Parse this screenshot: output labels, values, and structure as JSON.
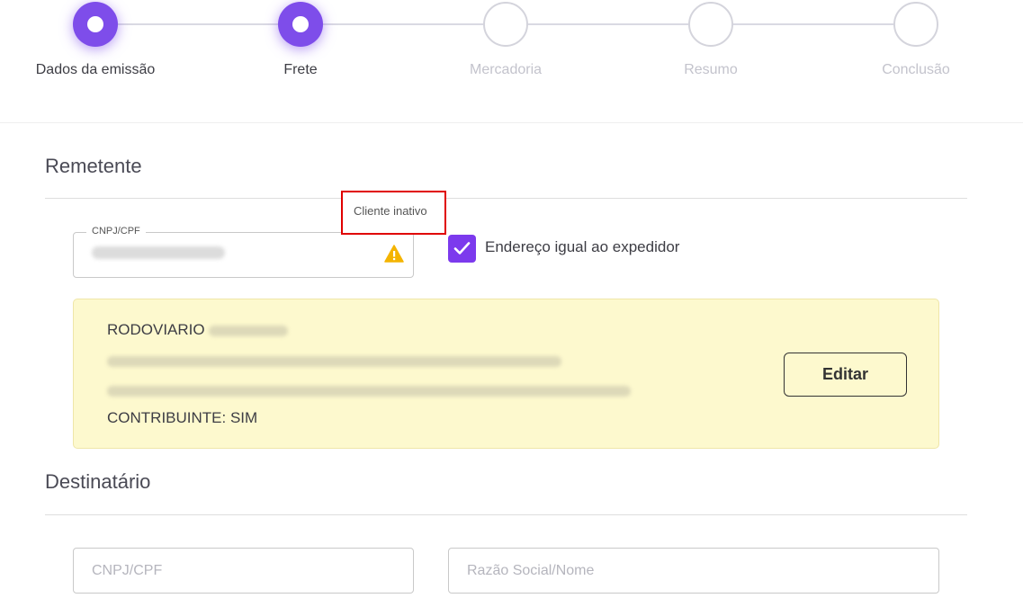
{
  "stepper": {
    "steps": [
      {
        "label": "Dados da emissão",
        "state": "completed"
      },
      {
        "label": "Frete",
        "state": "completed"
      },
      {
        "label": "Mercadoria",
        "state": "pending"
      },
      {
        "label": "Resumo",
        "state": "pending"
      },
      {
        "label": "Conclusão",
        "state": "pending"
      }
    ]
  },
  "remetente": {
    "title": "Remetente",
    "cnpj_field": {
      "legend": "CNPJ/CPF",
      "icon": "warning-icon"
    },
    "tooltip": "Cliente inativo",
    "same_address_checkbox": {
      "label": "Endereço igual ao expedidor",
      "checked": true
    },
    "client_card": {
      "name": "RODOVIARIO",
      "contribuinte": "CONTRIBUINTE: SIM",
      "edit_label": "Editar"
    }
  },
  "destinatario": {
    "title": "Destinatário",
    "cnpj_placeholder": "CNPJ/CPF",
    "razao_placeholder": "Razão Social/Nome"
  },
  "colors": {
    "accent": "#7c3aed",
    "card_background": "#fdf9ce",
    "warning": "#f4b400",
    "tooltip_border": "#e00000"
  }
}
